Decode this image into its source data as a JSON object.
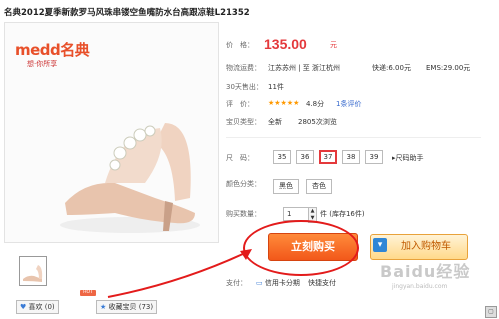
{
  "title": "名典2012夏季新款罗马风珠串镂空鱼嘴防水台高跟凉鞋L21352",
  "brand": {
    "logo": "medd名典",
    "slogan": "想·你所享"
  },
  "price": {
    "label": "价　格：",
    "value": "135.00",
    "unit": "元"
  },
  "shipping": {
    "label": "物流运费：",
    "route": "江苏苏州 | 至 浙江杭州",
    "express": "快递:6.00元",
    "ems": "EMS:29.00元"
  },
  "sales": {
    "label": "30天售出：",
    "value": "11件"
  },
  "rating": {
    "label": "评　价：",
    "stars": "★★★★★",
    "score": "4.8分",
    "reviews": "1条评价"
  },
  "condition": {
    "label": "宝贝类型：",
    "value": "全新",
    "views": "2805次浏览"
  },
  "sizes": {
    "label": "尺　码：",
    "options": [
      "35",
      "36",
      "37",
      "38",
      "39"
    ],
    "selected": "37",
    "helper": "尺码助手"
  },
  "colors": {
    "label": "颜色分类：",
    "options": [
      "黑色",
      "杏色"
    ]
  },
  "quantity": {
    "label": "购买数量：",
    "value": "1",
    "stock": "件 (库存16件)"
  },
  "buy_button": "立刻购买",
  "cart_button": "加入购物车",
  "payment": {
    "label": "支付：",
    "card": "信用卡分期",
    "method": "快捷支付"
  },
  "footer": {
    "like": "喜欢",
    "like_count": "(0)",
    "hot": "HOT",
    "favorite": "收藏宝贝",
    "favorite_count": "(73)"
  },
  "watermark": {
    "main": "Baidu经验",
    "url": "jingyan.baidu.com"
  },
  "colors_theme": {
    "accent": "#e4393c",
    "buy": "#f2581a",
    "annotation": "#e31b1b"
  }
}
